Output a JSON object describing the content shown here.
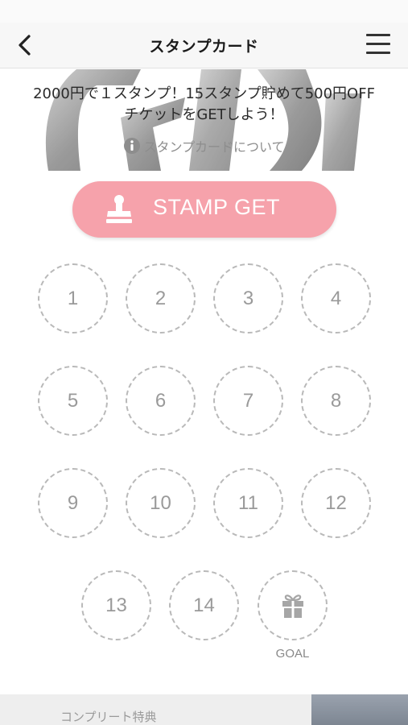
{
  "header": {
    "title": "スタンプカード"
  },
  "banner": {
    "promo_line1": "2000円で１スタンプ！15スタンプ貯めて500円OFF",
    "promo_line2": "チケットをGETしよう！",
    "info_link": "スタンプカードについて"
  },
  "stamp_button": {
    "label": "STAMP GET",
    "color": "#f6a2ab"
  },
  "stamps": {
    "slots": [
      "1",
      "2",
      "3",
      "4",
      "5",
      "6",
      "7",
      "8",
      "9",
      "10",
      "11",
      "12",
      "13",
      "14"
    ],
    "goal_label": "GOAL",
    "goal_icon": "gift-icon"
  },
  "footer": {
    "label": "コンプリート特典"
  },
  "colors": {
    "slot_border": "#b9b9b9",
    "slot_text": "#9a9a9a",
    "navbar_bg": "#f7f7f7"
  }
}
